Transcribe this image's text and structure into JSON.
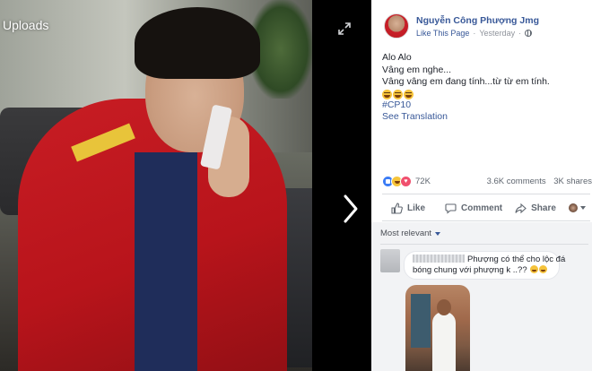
{
  "viewer": {
    "album_label": "Uploads",
    "expand_icon": "expand-arrows-icon",
    "next_icon": "chevron-right-icon"
  },
  "post": {
    "author": "Nguyễn Công Phượng Jmg",
    "like_page": "Like This Page",
    "separator": "·",
    "time": "Yesterday",
    "separator2": "·",
    "audience_icon": "globe-icon",
    "lines": [
      "Alo Alo",
      "Vâng em nghe...",
      "Vâng vâng em đang tính...từ từ em tính."
    ],
    "emoji_count": 3,
    "hashtag": "#CP10",
    "see_translation": "See Translation"
  },
  "reactions": {
    "icons": [
      "like",
      "haha",
      "love"
    ],
    "count": "72K",
    "comments": "3.6K comments",
    "shares": "3K shares"
  },
  "actions": {
    "like": "Like",
    "comment": "Comment",
    "share": "Share"
  },
  "comments": {
    "sort_label": "Most relevant",
    "items": [
      {
        "text_line1": "Phượng có thể cho lộc đá",
        "text_line2": "bóng chung với phượng k ..??",
        "emoji_count": 2
      }
    ]
  },
  "colors": {
    "link_blue": "#385898",
    "panel_bg": "#ffffff",
    "comments_bg": "#f2f3f5",
    "text": "#1d2129",
    "muted": "#90949c"
  }
}
